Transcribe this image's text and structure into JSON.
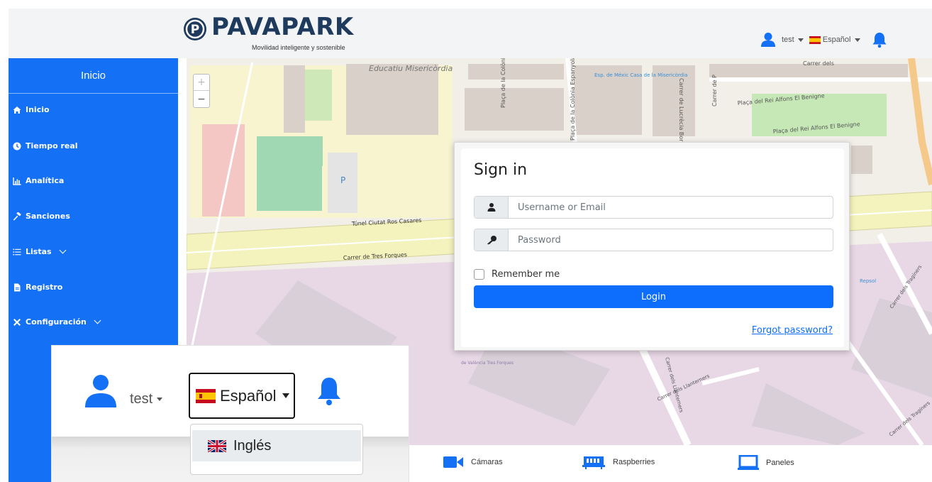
{
  "header": {
    "brand": "PAVAPARK",
    "tagline": "Movilidad inteligente y sostenible",
    "user": "test",
    "language": "Español"
  },
  "sidebar": {
    "title": "Inicio",
    "items": [
      {
        "label": "Inicio",
        "icon": "home-icon"
      },
      {
        "label": "Tiempo real",
        "icon": "clock-icon"
      },
      {
        "label": "Analítica",
        "icon": "chart-icon"
      },
      {
        "label": "Sanciones",
        "icon": "gavel-icon"
      },
      {
        "label": "Listas",
        "icon": "list-icon"
      },
      {
        "label": "Registro",
        "icon": "file-icon"
      },
      {
        "label": "Configuración",
        "icon": "tools-icon"
      }
    ]
  },
  "map": {
    "labels": [
      "Educatiu Misericòrdia",
      "Plaça de la Colònia",
      "Plaça de la Colònia Espanyola",
      "Esp. de Méxic Casa de la Misericòrdia",
      "Carrer de Lucrècia Bori",
      "Carrer de P",
      "Plaça del Rei Alfons El Benigne",
      "Plaça del Rei Alfons El Benigne",
      "Túnel Ciutat Ros Casares",
      "Carrer de Tres Forques",
      "Carrer dels Llanterners",
      "Carrer dels Llanterners",
      "Carrer dels Tragíners",
      "Carrer dels Tragíners",
      "Repsol",
      "de València Tres Forques",
      "Carrer dels",
      "P"
    ]
  },
  "signin": {
    "title": "Sign in",
    "username_placeholder": "Username or Email",
    "password_placeholder": "Password",
    "remember_label": "Remember me",
    "login_label": "Login",
    "forgot_label": "Forgot password?"
  },
  "inset": {
    "user": "test",
    "language": "Español",
    "menu_option": "Inglés"
  },
  "legend": [
    {
      "label": "Cámaras",
      "icon": "camera-icon"
    },
    {
      "label": "Raspberries",
      "icon": "raspberry-board-icon"
    },
    {
      "label": "Paneles",
      "icon": "panel-screen-icon"
    }
  ],
  "colors": {
    "primary": "#1470f5",
    "button": "#0d6efd",
    "brand_dark": "#1e3a5c",
    "map_background": "#f2efe9",
    "residential": "#e8d8e6"
  }
}
